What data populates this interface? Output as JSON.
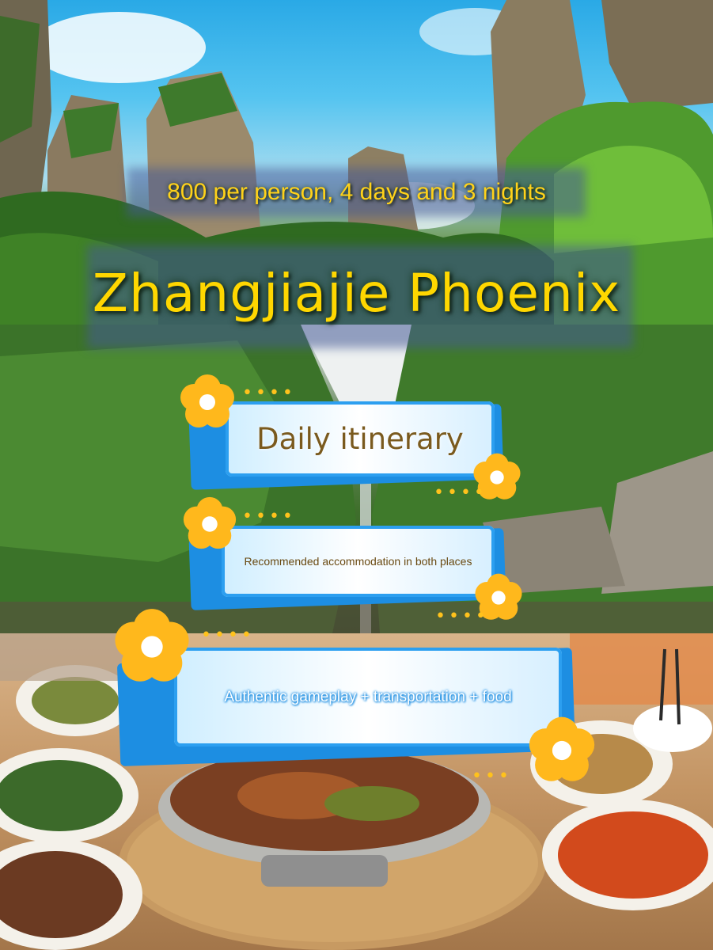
{
  "headline": {
    "price_line": "800 per person, 4 days and 3 nights",
    "title": "Zhangjiajie Phoenix"
  },
  "tags": [
    {
      "label": "Daily itinerary"
    },
    {
      "label": "Recommended accommodation in both places"
    },
    {
      "label": "Authentic gameplay + transportation + food"
    }
  ],
  "colors": {
    "title_yellow": "#ffd700",
    "tag_blue": "#1d8ee2",
    "flower_orange": "#ffb81c"
  }
}
